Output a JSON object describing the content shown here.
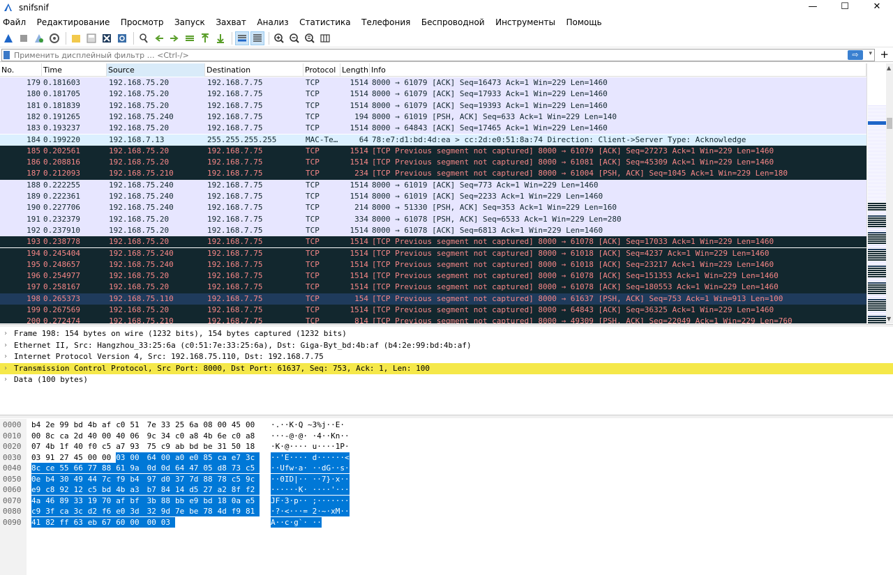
{
  "window": {
    "title": "snifsnif",
    "minimize": "—",
    "maximize": "☐",
    "close": "✕"
  },
  "menu": [
    "Файл",
    "Редактирование",
    "Просмотр",
    "Запуск",
    "Захват",
    "Анализ",
    "Статистика",
    "Телефония",
    "Беспроводной",
    "Инструменты",
    "Помощь"
  ],
  "toolbar_icons": [
    "shark-fin-start-icon",
    "stop-icon",
    "restart-icon",
    "options-gear-icon",
    "open-file-icon",
    "save-file-icon",
    "close-file-icon",
    "reload-icon",
    "find-packet-icon",
    "go-back-icon",
    "go-forward-icon",
    "go-to-packet-icon",
    "go-first-icon",
    "go-last-icon",
    "autoscroll-icon",
    "colorize-icon",
    "zoom-in-icon",
    "zoom-out-icon",
    "zoom-normal-icon",
    "resize-columns-icon"
  ],
  "filter": {
    "placeholder": "Применить дисплейный фильтр … <Ctrl-/>",
    "apply": "⇨",
    "dropdown": "▾",
    "add": "+"
  },
  "columns": [
    "No.",
    "Time",
    "Source",
    "Destination",
    "Protocol",
    "Length",
    "Info"
  ],
  "packets": [
    {
      "no": "179",
      "time": "0.181603",
      "src": "192.168.75.20",
      "dst": "192.168.7.75",
      "proto": "TCP",
      "len": "1514",
      "info": "8000 → 61079 [ACK] Seq=16473 Ack=1 Win=229 Len=1460",
      "style": "tcp"
    },
    {
      "no": "180",
      "time": "0.181705",
      "src": "192.168.75.20",
      "dst": "192.168.7.75",
      "proto": "TCP",
      "len": "1514",
      "info": "8000 → 61079 [ACK] Seq=17933 Ack=1 Win=229 Len=1460",
      "style": "tcp"
    },
    {
      "no": "181",
      "time": "0.181839",
      "src": "192.168.75.20",
      "dst": "192.168.7.75",
      "proto": "TCP",
      "len": "1514",
      "info": "8000 → 61079 [ACK] Seq=19393 Ack=1 Win=229 Len=1460",
      "style": "tcp"
    },
    {
      "no": "182",
      "time": "0.191265",
      "src": "192.168.75.240",
      "dst": "192.168.7.75",
      "proto": "TCP",
      "len": "194",
      "info": "8000 → 61019 [PSH, ACK] Seq=633 Ack=1 Win=229 Len=140",
      "style": "tcp"
    },
    {
      "no": "183",
      "time": "0.193237",
      "src": "192.168.75.20",
      "dst": "192.168.7.75",
      "proto": "TCP",
      "len": "1514",
      "info": "8000 → 64843 [ACK] Seq=17465 Ack=1 Win=229 Len=1460",
      "style": "tcp"
    },
    {
      "no": "184",
      "time": "0.199220",
      "src": "192.168.7.13",
      "dst": "255.255.255.255",
      "proto": "MAC-Te…",
      "len": "64",
      "info": "78:e7:d1:bd:4d:ea > cc:2d:e0:51:8a:74 Direction: Client->Server Type: Acknowledge",
      "style": "mac"
    },
    {
      "no": "185",
      "time": "0.202561",
      "src": "192.168.75.20",
      "dst": "192.168.7.75",
      "proto": "TCP",
      "len": "1514",
      "info": "[TCP Previous segment not captured] 8000 → 61079 [ACK] Seq=27273 Ack=1 Win=229 Len=1460",
      "style": "bad"
    },
    {
      "no": "186",
      "time": "0.208816",
      "src": "192.168.75.20",
      "dst": "192.168.7.75",
      "proto": "TCP",
      "len": "1514",
      "info": "[TCP Previous segment not captured] 8000 → 61081 [ACK] Seq=45309 Ack=1 Win=229 Len=1460",
      "style": "bad"
    },
    {
      "no": "187",
      "time": "0.212093",
      "src": "192.168.75.210",
      "dst": "192.168.7.75",
      "proto": "TCP",
      "len": "234",
      "info": "[TCP Previous segment not captured] 8000 → 61004 [PSH, ACK] Seq=1045 Ack=1 Win=229 Len=180",
      "style": "bad"
    },
    {
      "no": "188",
      "time": "0.222255",
      "src": "192.168.75.240",
      "dst": "192.168.7.75",
      "proto": "TCP",
      "len": "1514",
      "info": "8000 → 61019 [ACK] Seq=773 Ack=1 Win=229 Len=1460",
      "style": "tcp"
    },
    {
      "no": "189",
      "time": "0.222361",
      "src": "192.168.75.240",
      "dst": "192.168.7.75",
      "proto": "TCP",
      "len": "1514",
      "info": "8000 → 61019 [ACK] Seq=2233 Ack=1 Win=229 Len=1460",
      "style": "tcp"
    },
    {
      "no": "190",
      "time": "0.227706",
      "src": "192.168.75.240",
      "dst": "192.168.7.75",
      "proto": "TCP",
      "len": "214",
      "info": "8000 → 51330 [PSH, ACK] Seq=353 Ack=1 Win=229 Len=160",
      "style": "tcp"
    },
    {
      "no": "191",
      "time": "0.232379",
      "src": "192.168.75.20",
      "dst": "192.168.7.75",
      "proto": "TCP",
      "len": "334",
      "info": "8000 → 61078 [PSH, ACK] Seq=6533 Ack=1 Win=229 Len=280",
      "style": "tcp"
    },
    {
      "no": "192",
      "time": "0.237910",
      "src": "192.168.75.20",
      "dst": "192.168.7.75",
      "proto": "TCP",
      "len": "1514",
      "info": "8000 → 61078 [ACK] Seq=6813 Ack=1 Win=229 Len=1460",
      "style": "tcp"
    },
    {
      "no": "193",
      "time": "0.238778",
      "src": "192.168.75.20",
      "dst": "192.168.7.75",
      "proto": "TCP",
      "len": "1514",
      "info": "[TCP Previous segment not captured] 8000 → 61078 [ACK] Seq=17033 Ack=1 Win=229 Len=1460",
      "style": "bad"
    },
    {
      "no": "194",
      "time": "0.245404",
      "src": "192.168.75.240",
      "dst": "192.168.7.75",
      "proto": "TCP",
      "len": "1514",
      "info": "[TCP Previous segment not captured] 8000 → 61018 [ACK] Seq=4237 Ack=1 Win=229 Len=1460",
      "style": "bad"
    },
    {
      "no": "195",
      "time": "0.248657",
      "src": "192.168.75.240",
      "dst": "192.168.7.75",
      "proto": "TCP",
      "len": "1514",
      "info": "[TCP Previous segment not captured] 8000 → 61018 [ACK] Seq=23217 Ack=1 Win=229 Len=1460",
      "style": "bad"
    },
    {
      "no": "196",
      "time": "0.254977",
      "src": "192.168.75.20",
      "dst": "192.168.7.75",
      "proto": "TCP",
      "len": "1514",
      "info": "[TCP Previous segment not captured] 8000 → 61078 [ACK] Seq=151353 Ack=1 Win=229 Len=1460",
      "style": "bad"
    },
    {
      "no": "197",
      "time": "0.258167",
      "src": "192.168.75.20",
      "dst": "192.168.7.75",
      "proto": "TCP",
      "len": "1514",
      "info": "[TCP Previous segment not captured] 8000 → 61078 [ACK] Seq=180553 Ack=1 Win=229 Len=1460",
      "style": "bad"
    },
    {
      "no": "198",
      "time": "0.265373",
      "src": "192.168.75.110",
      "dst": "192.168.7.75",
      "proto": "TCP",
      "len": "154",
      "info": "[TCP Previous segment not captured] 8000 → 61637 [PSH, ACK] Seq=753 Ack=1 Win=913 Len=100",
      "style": "sel"
    },
    {
      "no": "199",
      "time": "0.267569",
      "src": "192.168.75.20",
      "dst": "192.168.7.75",
      "proto": "TCP",
      "len": "1514",
      "info": "[TCP Previous segment not captured] 8000 → 64843 [ACK] Seq=36325 Ack=1 Win=229 Len=1460",
      "style": "bad"
    },
    {
      "no": "200",
      "time": "0.272474",
      "src": "192.168.75.210",
      "dst": "192.168.7.75",
      "proto": "TCP",
      "len": "814",
      "info": "[TCP Previous segment not captured] 8000 → 49309 [PSH, ACK] Seq=22049 Ack=1 Win=229 Len=760",
      "style": "bad"
    }
  ],
  "details": [
    {
      "text": "Frame 198: 154 bytes on wire (1232 bits), 154 bytes captured (1232 bits)",
      "hl": false
    },
    {
      "text": "Ethernet II, Src: Hangzhou_33:25:6a (c0:51:7e:33:25:6a), Dst: Giga-Byt_bd:4b:af (b4:2e:99:bd:4b:af)",
      "hl": false
    },
    {
      "text": "Internet Protocol Version 4, Src: 192.168.75.110, Dst: 192.168.7.75",
      "hl": false
    },
    {
      "text": "Transmission Control Protocol, Src Port: 8000, Dst Port: 61637, Seq: 753, Ack: 1, Len: 100",
      "hl": true
    },
    {
      "text": "Data (100 bytes)",
      "hl": false
    }
  ],
  "detail_arrow": "›",
  "bytes": [
    {
      "off": "0000",
      "hex": [
        "b4",
        "2e",
        "99",
        "bd",
        "4b",
        "af",
        "c0",
        "51",
        "7e",
        "33",
        "25",
        "6a",
        "08",
        "00",
        "45",
        "00"
      ],
      "ascii": "·.··K·Q ~3%j··E·"
    },
    {
      "off": "0010",
      "hex": [
        "00",
        "8c",
        "ca",
        "2d",
        "40",
        "00",
        "40",
        "06",
        "9c",
        "34",
        "c0",
        "a8",
        "4b",
        "6e",
        "c0",
        "a8"
      ],
      "ascii": "···-@·@· ·4··Kn··"
    },
    {
      "off": "0020",
      "hex": [
        "07",
        "4b",
        "1f",
        "40",
        "f0",
        "c5",
        "a7",
        "93",
        "75",
        "c9",
        "ab",
        "bd",
        "be",
        "31",
        "50",
        "18"
      ],
      "ascii": "·K·@···· u····1P·"
    },
    {
      "off": "0030",
      "hex": [
        "03",
        "91",
        "27",
        "45",
        "00",
        "00",
        "03",
        "00",
        "64",
        "00",
        "a0",
        "e0",
        "85",
        "ca",
        "e7",
        "3c"
      ],
      "ascii": "··'E···· d······<"
    },
    {
      "off": "0040",
      "hex": [
        "8c",
        "ce",
        "55",
        "66",
        "77",
        "88",
        "61",
        "9a",
        "0d",
        "0d",
        "64",
        "47",
        "05",
        "d8",
        "73",
        "c5"
      ],
      "ascii": "··Ufw·a· ··dG··s·"
    },
    {
      "off": "0050",
      "hex": [
        "0e",
        "b4",
        "30",
        "49",
        "44",
        "7c",
        "f9",
        "b4",
        "97",
        "d0",
        "37",
        "7d",
        "88",
        "78",
        "c5",
        "9c"
      ],
      "ascii": "··0ID|·· ··7}·x··"
    },
    {
      "off": "0060",
      "hex": [
        "e9",
        "c8",
        "92",
        "12",
        "c5",
        "bd",
        "4b",
        "a3",
        "b7",
        "84",
        "14",
        "d5",
        "27",
        "a2",
        "8f",
        "f2"
      ],
      "ascii": "······K· ····'···"
    },
    {
      "off": "0070",
      "hex": [
        "4a",
        "46",
        "89",
        "33",
        "19",
        "70",
        "af",
        "bf",
        "3b",
        "88",
        "bb",
        "e9",
        "bd",
        "18",
        "0a",
        "e5"
      ],
      "ascii": "JF·3·p·· ;·······"
    },
    {
      "off": "0080",
      "hex": [
        "c9",
        "3f",
        "ca",
        "3c",
        "d2",
        "f6",
        "e0",
        "3d",
        "32",
        "9d",
        "7e",
        "be",
        "78",
        "4d",
        "f9",
        "81"
      ],
      "ascii": "·?·<···= 2·~·xM··"
    },
    {
      "off": "0090",
      "hex": [
        "41",
        "82",
        "ff",
        "63",
        "eb",
        "67",
        "60",
        "00",
        "00",
        "03"
      ],
      "ascii": "A··c·g`· ··"
    }
  ],
  "selected_byte_start": 54
}
